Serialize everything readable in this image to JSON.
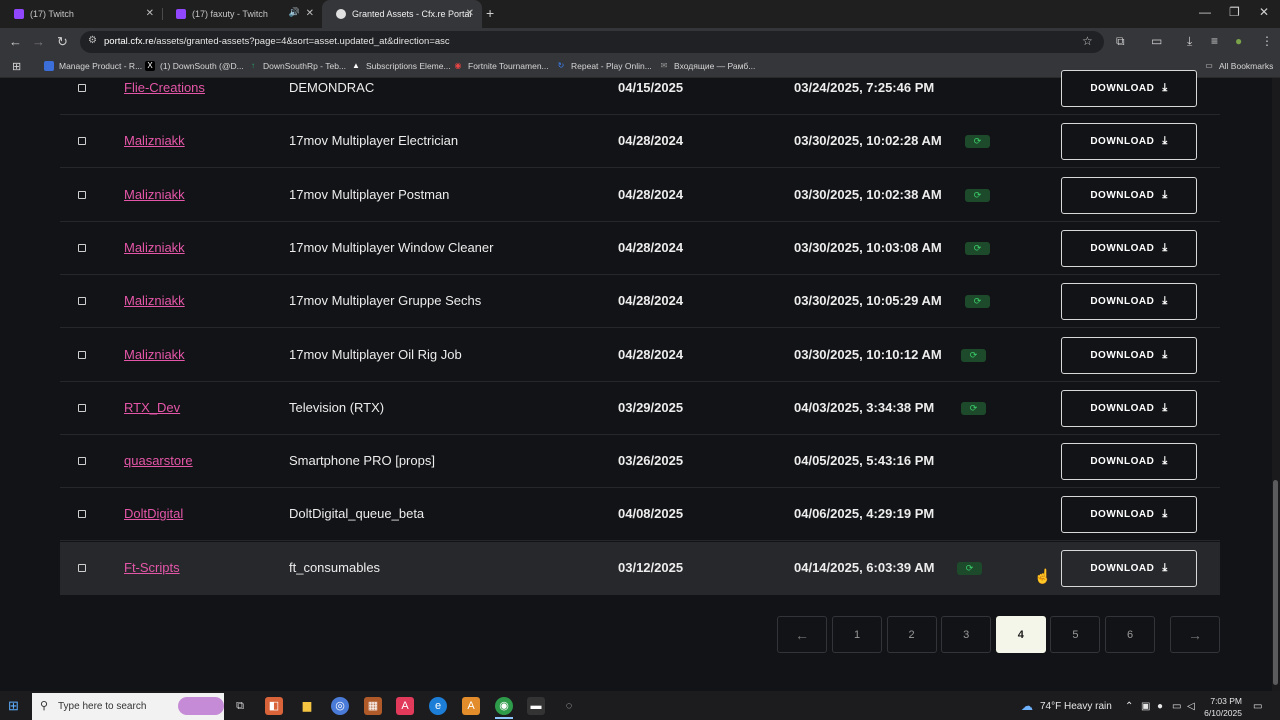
{
  "tabs": [
    {
      "label": "(17) Twitch",
      "close": "✕"
    },
    {
      "label": "(17) faxuty - Twitch",
      "close": "✕",
      "audio": "🔊"
    },
    {
      "label": "Granted Assets - Cfx.re Portal",
      "close": "✕"
    }
  ],
  "new_tab": "+",
  "window_controls": {
    "minimize": "—",
    "maximize": "❐",
    "close": "✕"
  },
  "nav": {
    "back": "←",
    "forward": "→",
    "reload": "↻"
  },
  "address": {
    "host": "portal.cfx.re",
    "path": "/assets/granted-assets?page=4&sort=asset.updated_at&direction=asc"
  },
  "toolbar_icons": {
    "star": "☆",
    "extensions": "⧉",
    "cast": "▭",
    "downloads": "⤓",
    "media": "≡",
    "profile": "●",
    "menu": "⋮"
  },
  "bookmarks": [
    {
      "label": "Manage Product - R...",
      "color": "#3b6ed8",
      "glyph": "●"
    },
    {
      "label": "(1) DownSouth (@D...",
      "color": "#000000",
      "glyph": "X"
    },
    {
      "label": "DownSouthRp - Teb...",
      "color": "#2aa36b",
      "glyph": "↑"
    },
    {
      "label": "Subscriptions Eleme...",
      "color": "#000000",
      "glyph": "▲"
    },
    {
      "label": "Fortnite Tournamen...",
      "color": "#e84545",
      "glyph": "◉"
    },
    {
      "label": "Repeat - Play Onlin...",
      "color": "#3b82f6",
      "glyph": "↻"
    },
    {
      "label": "Входящие — Рамб...",
      "color": "#666666",
      "glyph": "✉"
    }
  ],
  "all_bookmarks": "All Bookmarks",
  "rows": [
    {
      "author": "Flie-Creations",
      "asset": "DEMONDRAC",
      "granted": "04/15/2025",
      "updated": "03/24/2025, 7:25:46 PM",
      "sync": false
    },
    {
      "author": "Malizniakk",
      "asset": "17mov Multiplayer Electrician",
      "granted": "04/28/2024",
      "updated": "03/30/2025, 10:02:28 AM",
      "sync": true
    },
    {
      "author": "Malizniakk",
      "asset": "17mov Multiplayer Postman",
      "granted": "04/28/2024",
      "updated": "03/30/2025, 10:02:38 AM",
      "sync": true
    },
    {
      "author": "Malizniakk",
      "asset": "17mov Multiplayer Window Cleaner",
      "granted": "04/28/2024",
      "updated": "03/30/2025, 10:03:08 AM",
      "sync": true
    },
    {
      "author": "Malizniakk",
      "asset": "17mov Multiplayer Gruppe Sechs",
      "granted": "04/28/2024",
      "updated": "03/30/2025, 10:05:29 AM",
      "sync": true
    },
    {
      "author": "Malizniakk",
      "asset": "17mov Multiplayer Oil Rig Job",
      "granted": "04/28/2024",
      "updated": "03/30/2025, 10:10:12 AM",
      "sync": true
    },
    {
      "author": "RTX_Dev",
      "asset": "Television (RTX)",
      "granted": "03/29/2025",
      "updated": "04/03/2025, 3:34:38 PM",
      "sync": true
    },
    {
      "author": "quasarstore",
      "asset": "Smartphone PRO [props]",
      "granted": "03/26/2025",
      "updated": "04/05/2025, 5:43:16 PM",
      "sync": false
    },
    {
      "author": "DoltDigital",
      "asset": "DoltDigital_queue_beta",
      "granted": "04/08/2025",
      "updated": "04/06/2025, 4:29:19 PM",
      "sync": false
    },
    {
      "author": "Ft-Scripts",
      "asset": "ft_consumables",
      "granted": "03/12/2025",
      "updated": "04/14/2025, 6:03:39 AM",
      "sync": true
    }
  ],
  "sync_glyph": "⟳",
  "download_label": "DOWNLOAD",
  "download_icon": "⤓",
  "pagination": {
    "prev": "←",
    "next": "→",
    "pages": [
      "1",
      "2",
      "3",
      "4",
      "5",
      "6"
    ],
    "current": "4"
  },
  "taskbar": {
    "search_placeholder": "Type here to search",
    "weather": "74°F  Heavy rain",
    "time": "7:03 PM",
    "date": "6/10/2025"
  }
}
